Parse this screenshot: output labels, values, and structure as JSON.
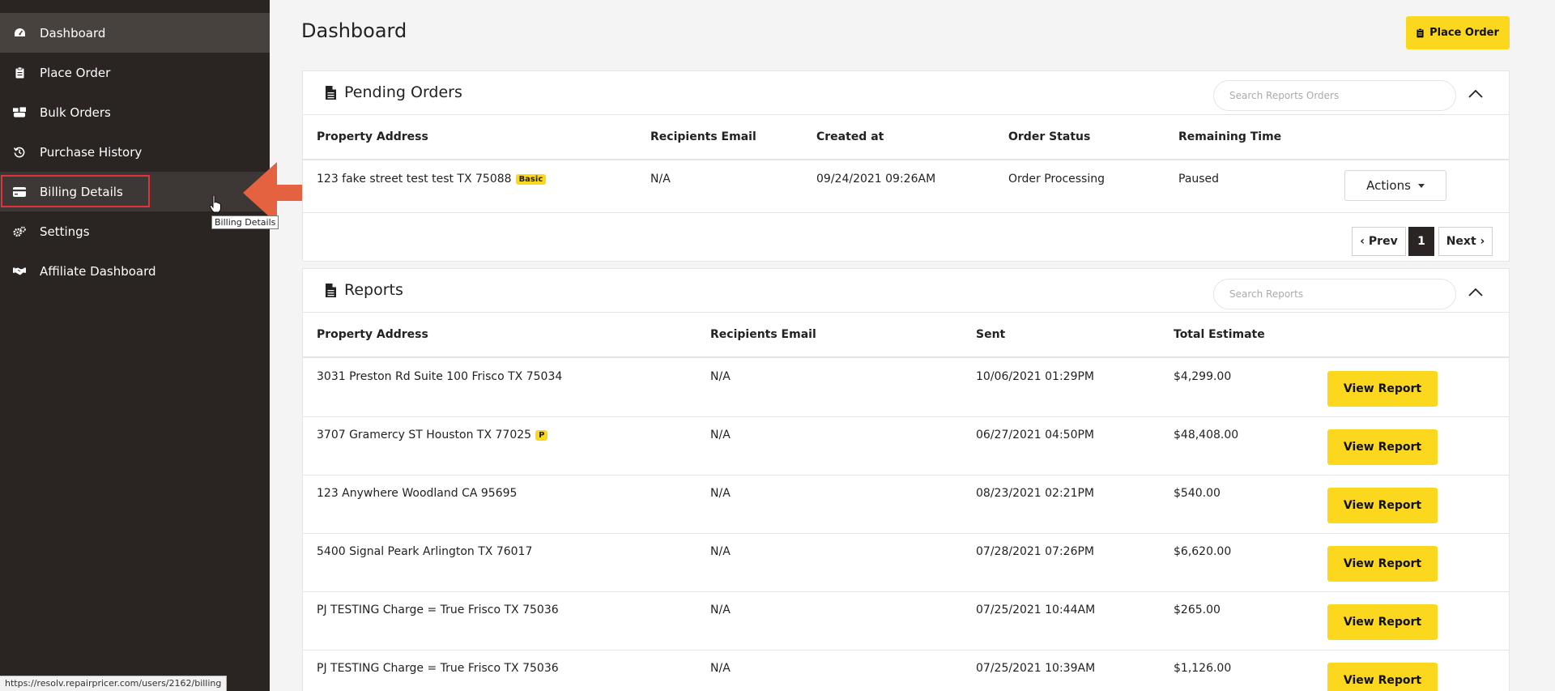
{
  "sidebar": {
    "items": [
      {
        "label": "Dashboard",
        "icon": "gauge-icon"
      },
      {
        "label": "Place Order",
        "icon": "clipboard-icon"
      },
      {
        "label": "Bulk Orders",
        "icon": "boxes-icon"
      },
      {
        "label": "Purchase History",
        "icon": "history-icon"
      },
      {
        "label": "Billing Details",
        "icon": "credit-card-icon"
      },
      {
        "label": "Settings",
        "icon": "cogs-icon"
      },
      {
        "label": "Affiliate Dashboard",
        "icon": "handshake-icon"
      }
    ],
    "tooltip": "Billing Details"
  },
  "status_bar": {
    "url": "https://resolv.repairpricer.com/users/2162/billing"
  },
  "header": {
    "title": "Dashboard",
    "place_order_label": "Place Order"
  },
  "pending_orders": {
    "title": "Pending Orders",
    "search_placeholder": "Search Reports Orders",
    "columns": [
      "Property Address",
      "Recipients Email",
      "Created at",
      "Order Status",
      "Remaining Time"
    ],
    "rows": [
      {
        "address": "123 fake street test test TX 75088",
        "badge": "Basic",
        "email": "N/A",
        "created": "09/24/2021 09:26AM",
        "status": "Order Processing",
        "remaining": "Paused",
        "action_label": "Actions"
      }
    ],
    "pagination": {
      "prev": "‹ Prev",
      "current": "1",
      "next": "Next ›"
    }
  },
  "reports": {
    "title": "Reports",
    "search_placeholder": "Search Reports",
    "columns": [
      "Property Address",
      "Recipients Email",
      "Sent",
      "Total Estimate"
    ],
    "view_label": "View Report",
    "rows": [
      {
        "address": "3031 Preston Rd Suite 100 Frisco TX 75034",
        "badge": "",
        "email": "N/A",
        "sent": "10/06/2021 01:29PM",
        "total": "$4,299.00"
      },
      {
        "address": "3707 Gramercy ST Houston TX 77025",
        "badge": "P",
        "email": "N/A",
        "sent": "06/27/2021 04:50PM",
        "total": "$48,408.00"
      },
      {
        "address": "123 Anywhere Woodland CA 95695",
        "badge": "",
        "email": "N/A",
        "sent": "08/23/2021 02:21PM",
        "total": "$540.00"
      },
      {
        "address": "5400 Signal Peark Arlington TX 76017",
        "badge": "",
        "email": "N/A",
        "sent": "07/28/2021 07:26PM",
        "total": "$6,620.00"
      },
      {
        "address": "PJ TESTING Charge = True Frisco TX 75036",
        "badge": "",
        "email": "N/A",
        "sent": "07/25/2021 10:44AM",
        "total": "$265.00"
      },
      {
        "address": "PJ TESTING Charge = True Frisco TX 75036",
        "badge": "",
        "email": "N/A",
        "sent": "07/25/2021 10:39AM",
        "total": "$1,126.00"
      }
    ]
  },
  "colors": {
    "sidebar_bg": "#2a2522",
    "accent_yellow": "#fbd71e",
    "highlight_red": "#e0333a",
    "arrow_orange": "#e4623f"
  }
}
